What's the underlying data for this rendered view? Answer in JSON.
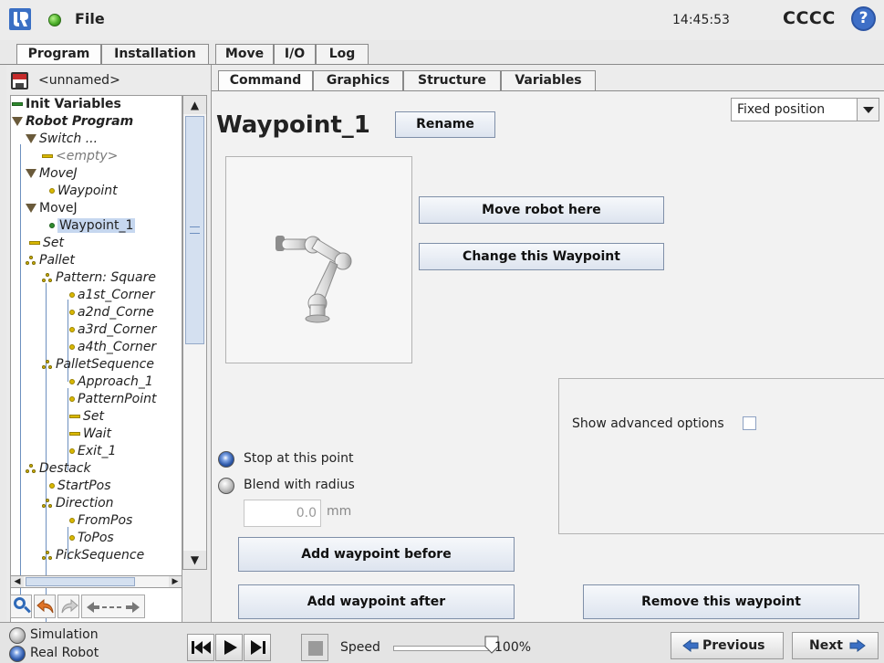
{
  "titlebar": {
    "file_menu": "File",
    "clock": "14:45:53",
    "robot_name": "CCCC",
    "help_glyph": "?"
  },
  "main_tabs": [
    "Program",
    "Installation",
    "Move",
    "I/O",
    "Log"
  ],
  "program_panel": {
    "program_name": "<unnamed>",
    "tree": [
      {
        "label": "Init Variables",
        "style": "bold",
        "icon": "variable-icon"
      },
      {
        "label": "Robot Program",
        "style": "bold-italic",
        "icon": "expand-icon"
      },
      {
        "label": "Switch ...",
        "style": "italic",
        "icon": "expand-icon"
      },
      {
        "label": "<empty>",
        "style": "gray-italic",
        "icon": "line-icon"
      },
      {
        "label": "MoveJ",
        "style": "italic",
        "icon": "expand-icon"
      },
      {
        "label": "Waypoint",
        "style": "italic",
        "icon": "waypoint-icon"
      },
      {
        "label": "MoveJ",
        "style": "normal",
        "icon": "expand-icon"
      },
      {
        "label": "Waypoint_1",
        "style": "selected",
        "icon": "waypoint-icon"
      },
      {
        "label": "Set",
        "style": "italic",
        "icon": "set-icon"
      },
      {
        "label": "Pallet",
        "style": "italic",
        "icon": "pallet-icon"
      },
      {
        "label": "Pattern: Square",
        "style": "italic",
        "icon": "pallet-icon"
      },
      {
        "label": "a1st_Corner",
        "style": "italic",
        "icon": "waypoint-icon"
      },
      {
        "label": "a2nd_Corne",
        "style": "italic",
        "icon": "waypoint-icon"
      },
      {
        "label": "a3rd_Corner",
        "style": "italic",
        "icon": "waypoint-icon"
      },
      {
        "label": "a4th_Corner",
        "style": "italic",
        "icon": "waypoint-icon"
      },
      {
        "label": "PalletSequence",
        "style": "italic",
        "icon": "pallet-icon"
      },
      {
        "label": "Approach_1",
        "style": "italic",
        "icon": "waypoint-icon"
      },
      {
        "label": "PatternPoint",
        "style": "italic",
        "icon": "waypoint-icon"
      },
      {
        "label": "Set",
        "style": "italic",
        "icon": "set-icon"
      },
      {
        "label": "Wait",
        "style": "italic",
        "icon": "set-icon"
      },
      {
        "label": "Exit_1",
        "style": "italic",
        "icon": "waypoint-icon"
      },
      {
        "label": "Destack",
        "style": "italic",
        "icon": "pallet-icon"
      },
      {
        "label": "StartPos",
        "style": "italic",
        "icon": "waypoint-icon"
      },
      {
        "label": "Direction",
        "style": "italic",
        "icon": "pallet-icon"
      },
      {
        "label": "FromPos",
        "style": "italic",
        "icon": "waypoint-icon"
      },
      {
        "label": "ToPos",
        "style": "italic",
        "icon": "waypoint-icon"
      },
      {
        "label": "PickSequence",
        "style": "italic",
        "icon": "pallet-icon"
      }
    ]
  },
  "sub_tabs": [
    "Command",
    "Graphics",
    "Structure",
    "Variables"
  ],
  "command": {
    "title": "Waypoint_1",
    "rename": "Rename",
    "position_type": "Fixed position",
    "move_robot_here": "Move robot here",
    "change_waypoint": "Change this Waypoint",
    "show_advanced": "Show advanced options",
    "stop_at_point": "Stop at this point",
    "blend_with_radius": "Blend with radius",
    "blend_radius_value": "0.0",
    "blend_radius_unit": "mm",
    "add_before": "Add waypoint before",
    "add_after": "Add waypoint after",
    "remove": "Remove this waypoint"
  },
  "bottombar": {
    "simulation": "Simulation",
    "real_robot": "Real Robot",
    "speed_label": "Speed",
    "speed_value": "100%",
    "speed_fraction": 1.0,
    "previous": "Previous",
    "next": "Next"
  },
  "colors": {
    "accent_blue": "#2f6ab8",
    "selection": "#c6d7ef",
    "button_border": "#7f8fa8"
  }
}
